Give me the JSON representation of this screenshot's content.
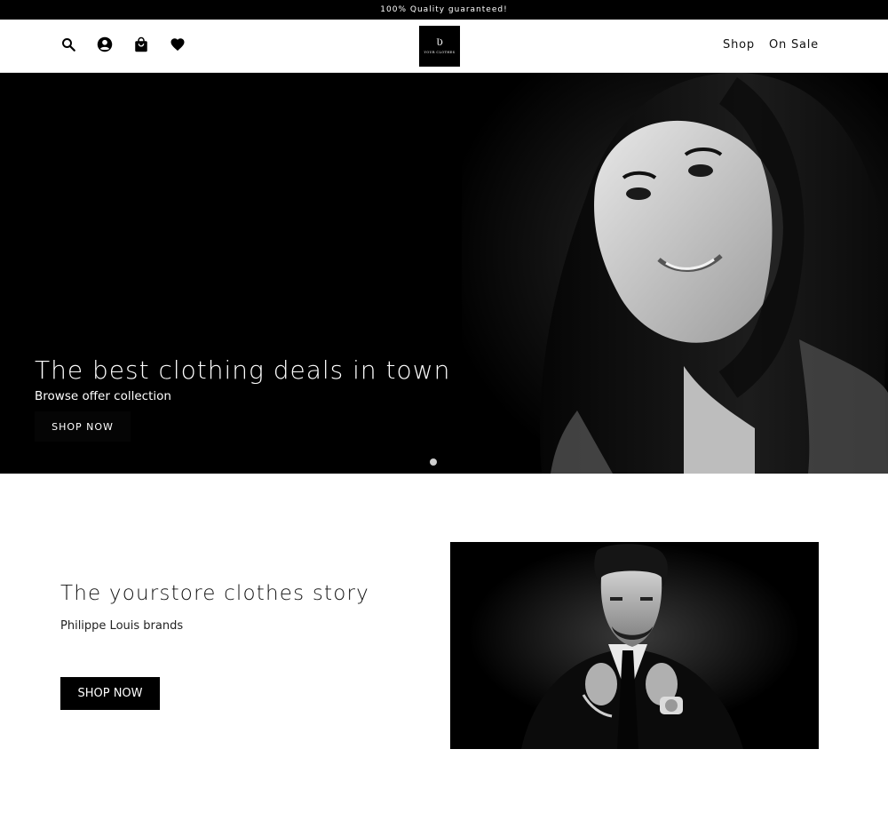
{
  "topbar": {
    "announcement": "100% Quality guaranteed!"
  },
  "header": {
    "icons": [
      "search-icon",
      "account-icon",
      "bag-icon",
      "heart-icon"
    ],
    "logo": {
      "mark": "Ʋ",
      "text": "YOUR CLOTHES"
    },
    "nav": [
      {
        "label": "Shop"
      },
      {
        "label": "On Sale"
      }
    ]
  },
  "hero": {
    "title": "The best clothing deals in town",
    "subtitle": "Browse offer collection",
    "button_label": "SHOP NOW",
    "slide_count": 1,
    "active_slide": 1
  },
  "story": {
    "title": "The yourstore clothes story",
    "subtitle": "Philippe Louis brands",
    "button_label": "SHOP NOW"
  },
  "colors": {
    "primary": "#000000",
    "background": "#ffffff",
    "text": "#111111",
    "dot": "#cfcfcf"
  }
}
